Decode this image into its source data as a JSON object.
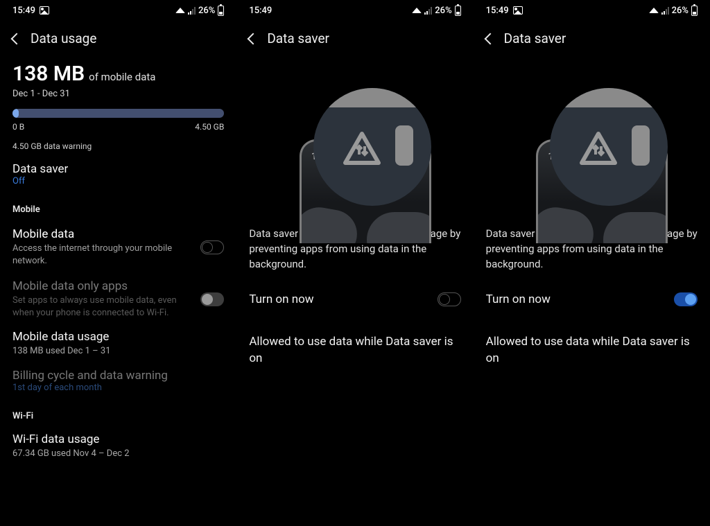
{
  "status": {
    "time": "15:49",
    "battery_pct": "26%"
  },
  "panels": [
    {
      "header_title": "Data usage",
      "usage_amount": "138 MB",
      "usage_of": "of mobile data",
      "period": "Dec 1 - Dec 31",
      "bar_min": "0 B",
      "bar_max": "4.50 GB",
      "warning_text": "4.50 GB data warning",
      "data_saver": {
        "title": "Data saver",
        "status": "Off"
      },
      "section_mobile": "Mobile",
      "mobile_data": {
        "title": "Mobile data",
        "sub": "Access the internet through your mobile network."
      },
      "mobile_only": {
        "title": "Mobile data only apps",
        "sub": "Set apps to always use mobile data, even when your phone is connected to Wi-Fi."
      },
      "mobile_usage": {
        "title": "Mobile data usage",
        "sub": "138 MB used Dec 1 – 31"
      },
      "billing": {
        "title": "Billing cycle and data warning",
        "sub": "1st day of each month"
      },
      "section_wifi": "Wi-Fi",
      "wifi_usage": {
        "title": "Wi-Fi data usage",
        "sub": "67.34 GB used Nov 4 – Dec 2"
      }
    },
    {
      "header_title": "Data saver",
      "phone_time": "12:45",
      "description": "Data saver helps cut down your data usage by preventing apps from using data in the background.",
      "turn_on_label": "Turn on now",
      "turn_on_state": "off",
      "allowed_label": "Allowed to use data while Data saver is on"
    },
    {
      "header_title": "Data saver",
      "phone_time": "12:45",
      "description": "Data saver helps cut down your data usage by preventing apps from using data in the background.",
      "turn_on_label": "Turn on now",
      "turn_on_state": "on",
      "allowed_label": "Allowed to use data while Data saver is on"
    }
  ]
}
